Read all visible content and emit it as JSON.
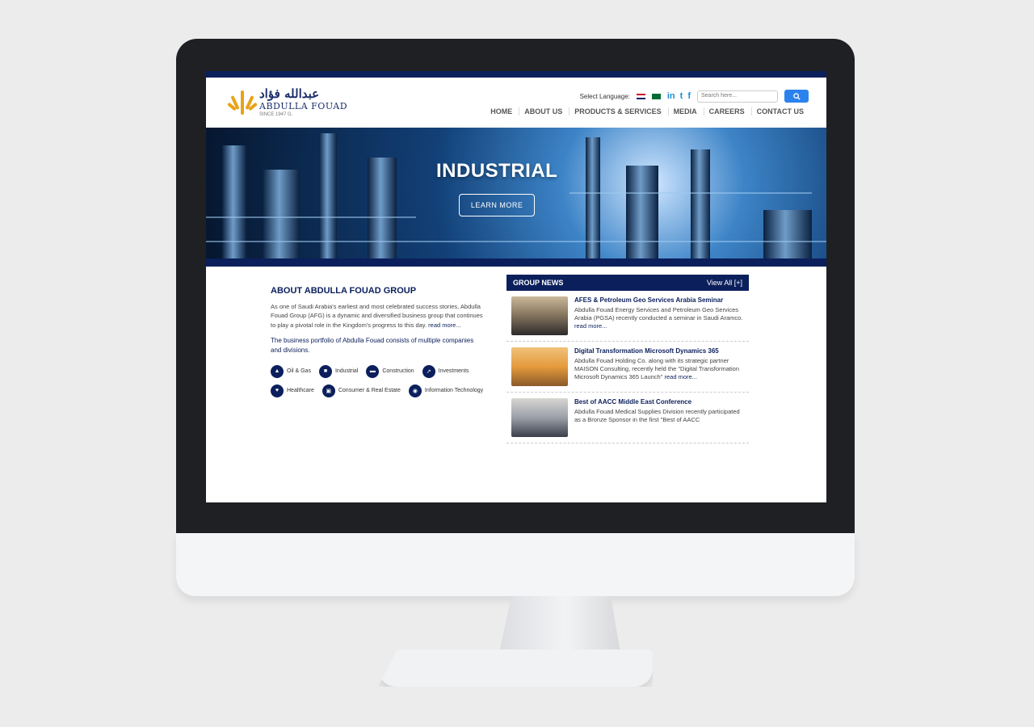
{
  "header": {
    "logo_arabic": "عبدالله فؤاد",
    "logo_name": "ABDULLA FOUAD",
    "logo_sub": "SINCE 1947 G.",
    "select_language": "Select Language:",
    "social": [
      "in",
      "t",
      "f"
    ],
    "search_placeholder": "Search here...",
    "nav": [
      "HOME",
      "ABOUT US",
      "PRODUCTS & SERVICES",
      "MEDIA",
      "CAREERS",
      "CONTACT US"
    ]
  },
  "hero": {
    "title": "INDUSTRIAL",
    "cta": "LEARN MORE"
  },
  "about": {
    "title": "ABOUT ABDULLA FOUAD GROUP",
    "p1": "As one of Saudi Arabia's earliest and most celebrated success stories, Abdulla Fouad Group (AFG) is a dynamic and diversified business group that continues to play a pivotal role in the Kingdom's progress to this day.",
    "read_more": "read more...",
    "p2": "The business portfolio of Abdulla Fouad consists of multiple companies and divisions.",
    "sectors": [
      "Oil & Gas",
      "Industrial",
      "Construction",
      "Investments",
      "Healthcare",
      "Consumer & Real Estate",
      "Information Technology"
    ]
  },
  "news": {
    "title": "GROUP NEWS",
    "view_all": "View All [+]",
    "items": [
      {
        "title": "AFES & Petroleum Geo Services Arabia Seminar",
        "body": "Abdulla Fouad Energy Services and Petroleum Geo Services Arabia (PGSA) recently conducted a seminar in Saudi Aramco.",
        "read_more": "read more..."
      },
      {
        "title": "Digital Transformation Microsoft Dynamics 365",
        "body": "Abdulla Fouad Holding Co. along with its strategic partner MAISON Consulting, recently held the \"Digital Transformation Microsoft Dynamics 365 Launch\"",
        "read_more": "read more..."
      },
      {
        "title": "Best of AACC Middle East Conference",
        "body": "Abdulla Fouad Medical Supplies Division recently participated as a Bronze Sponsor in the first \"Best of AACC",
        "read_more": ""
      }
    ]
  }
}
